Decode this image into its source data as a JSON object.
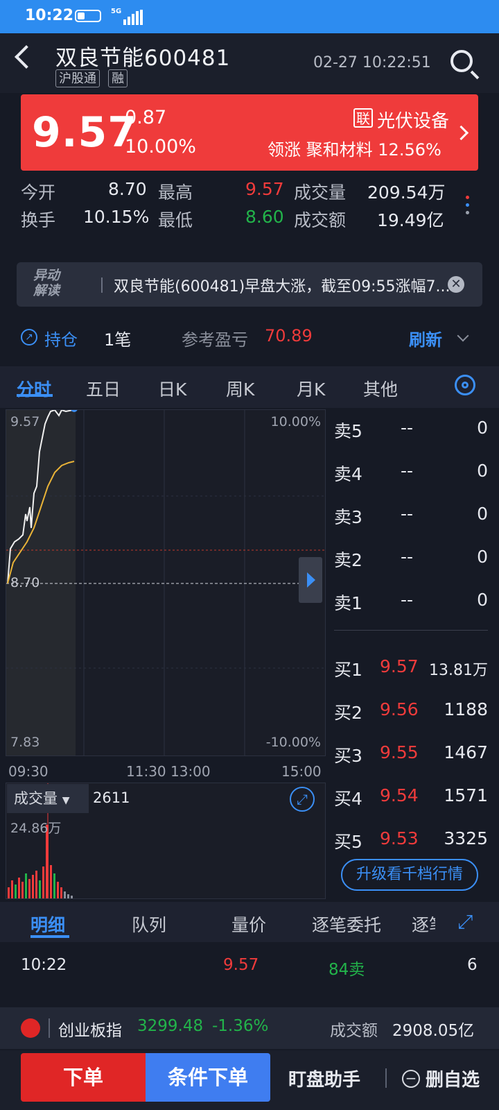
{
  "status_bar": {
    "time": "10:22",
    "network": "5G"
  },
  "header": {
    "title": "双良节能600481",
    "tags": [
      "沪股通",
      "融"
    ],
    "datetime": "02-27 10:22:51"
  },
  "quote": {
    "price": "9.57",
    "change": "0.87",
    "change_pct": "10.00%",
    "sector_badge": "联",
    "sector": "光伏设备",
    "lead_label": "领涨",
    "lead_stock": "聚和材料",
    "lead_pct": "12.56%"
  },
  "stats": {
    "open_label": "今开",
    "open": "8.70",
    "high_label": "最高",
    "high": "9.57",
    "volume_label": "成交量",
    "volume": "209.54万",
    "turnover_label": "换手",
    "turnover": "10.15%",
    "low_label": "最低",
    "low": "8.60",
    "amount_label": "成交额",
    "amount": "19.49亿"
  },
  "news": {
    "logo_line1": "异动",
    "logo_line2": "解读",
    "text": "双良节能(600481)早盘大涨，截至09:55涨幅7..."
  },
  "holdings": {
    "label": "持仓",
    "count": "1笔",
    "pnl_label": "参考盈亏",
    "pnl": "70.89",
    "refresh": "刷新"
  },
  "tabs": [
    "分时",
    "五日",
    "日K",
    "周K",
    "月K",
    "其他"
  ],
  "chart": {
    "price_top": "9.57",
    "pct_top": "10.00%",
    "price_mid": "8.70",
    "price_bottom": "7.83",
    "pct_bottom": "-10.00%",
    "times": [
      "09:30",
      "11:30 13:00",
      "15:00"
    ],
    "volume_label": "成交量",
    "volume_value": "2611",
    "volume_max": "24.86万"
  },
  "orderbook": {
    "sells": [
      {
        "label": "卖5",
        "price": "--",
        "vol": "0"
      },
      {
        "label": "卖4",
        "price": "--",
        "vol": "0"
      },
      {
        "label": "卖3",
        "price": "--",
        "vol": "0"
      },
      {
        "label": "卖2",
        "price": "--",
        "vol": "0"
      },
      {
        "label": "卖1",
        "price": "--",
        "vol": "0"
      }
    ],
    "buys": [
      {
        "label": "买1",
        "price": "9.57",
        "vol": "13.81万"
      },
      {
        "label": "买2",
        "price": "9.56",
        "vol": "1188"
      },
      {
        "label": "买3",
        "price": "9.55",
        "vol": "1467"
      },
      {
        "label": "买4",
        "price": "9.54",
        "vol": "1571"
      },
      {
        "label": "买5",
        "price": "9.53",
        "vol": "3325"
      }
    ],
    "upgrade": "升级看千档行情"
  },
  "detail_tabs": [
    "明细",
    "队列",
    "量价",
    "逐笔委托",
    "逐笔"
  ],
  "tick": {
    "time": "10:22",
    "price": "9.57",
    "side": "84卖",
    "count": "6"
  },
  "index": {
    "name": "创业板指",
    "value": "3299.48",
    "change": "-1.36%",
    "amount_label": "成交额",
    "amount": "2908.05亿"
  },
  "footer": {
    "order": "下单",
    "cond_order": "条件下单",
    "monitor": "盯盘助手",
    "remove": "删自选"
  }
}
